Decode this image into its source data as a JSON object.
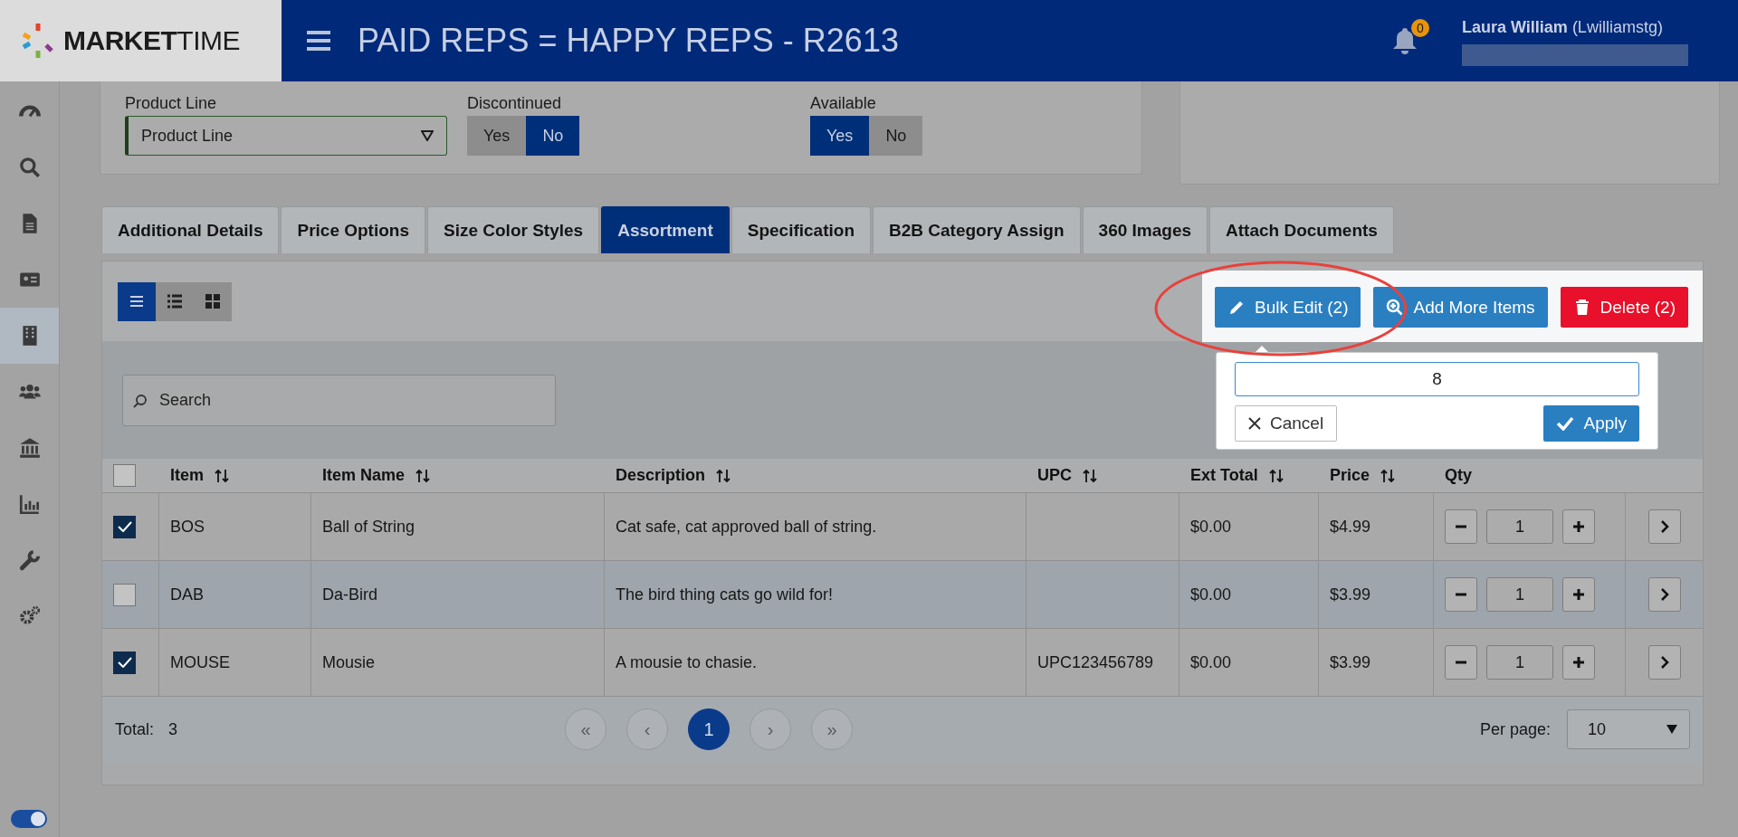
{
  "header": {
    "logo": "**MARKET**TIME",
    "title": "PAID REPS = HAPPY REPS - R2613",
    "notification_count": "0",
    "user_name": "Laura William",
    "user_login": "(Lwilliamstg)"
  },
  "sidebar": {
    "items": [
      {
        "kind": "dashboard",
        "selected": false
      },
      {
        "kind": "search",
        "selected": false
      },
      {
        "kind": "document",
        "selected": false
      },
      {
        "kind": "card",
        "selected": false
      },
      {
        "kind": "building",
        "selected": true
      },
      {
        "kind": "people",
        "selected": false
      },
      {
        "kind": "bank",
        "selected": false
      },
      {
        "kind": "chart",
        "selected": false
      },
      {
        "kind": "wrench",
        "selected": false
      },
      {
        "kind": "gears",
        "selected": false
      }
    ],
    "toggle_on": true
  },
  "filters": [
    {
      "kind": "select",
      "label": "Product Line",
      "value": "Product Line"
    },
    {
      "kind": "toggle",
      "label": "Discontinued",
      "options": [
        {
          "label": "Yes",
          "selected": false
        },
        {
          "label": "No",
          "selected": true
        }
      ]
    },
    {
      "kind": "toggle",
      "label": "Available",
      "options": [
        {
          "label": "Yes",
          "selected": true
        },
        {
          "label": "No",
          "selected": false
        }
      ]
    }
  ],
  "tabs": [
    {
      "label": "Additional Details",
      "selected": false
    },
    {
      "label": "Price Options",
      "selected": false
    },
    {
      "label": "Size Color Styles",
      "selected": false
    },
    {
      "label": "Assortment",
      "selected": true
    },
    {
      "label": "Specification",
      "selected": false
    },
    {
      "label": "B2B Category Assign",
      "selected": false
    },
    {
      "label": "360 Images",
      "selected": false
    },
    {
      "label": "Attach Documents",
      "selected": false
    }
  ],
  "view_modes": [
    {
      "kind": "list",
      "selected": true
    },
    {
      "kind": "table",
      "selected": false
    },
    {
      "kind": "grid",
      "selected": false
    }
  ],
  "actions": [
    {
      "kind": "edit",
      "label": "Bulk Edit (2)"
    },
    {
      "kind": "add",
      "label": "Add More Items"
    },
    {
      "kind": "delete",
      "label": "Delete (2)"
    }
  ],
  "bulk_edit_popover": {
    "value": "8",
    "cancel": "Cancel",
    "apply": "Apply"
  },
  "search": {
    "placeholder": "Search"
  },
  "table": {
    "all_selected": false,
    "columns": [
      {
        "label": "Item",
        "sortable": true
      },
      {
        "label": "Item Name",
        "sortable": true
      },
      {
        "label": "Description",
        "sortable": true
      },
      {
        "label": "UPC",
        "sortable": true
      },
      {
        "label": "Ext Total",
        "sortable": true
      },
      {
        "label": "Price",
        "sortable": true
      },
      {
        "label": "Qty",
        "sortable": false
      }
    ],
    "rows": [
      {
        "selected": true,
        "item": "BOS",
        "item_name": "Ball of String",
        "description": "Cat safe, cat approved ball of string.",
        "ext_total": "$0.00",
        "price": "$4.99",
        "qty": "1"
      },
      {
        "selected": false,
        "item": "DAB",
        "item_name": "Da-Bird",
        "description": "The bird thing cats go wild for!",
        "ext_total": "$0.00",
        "price": "$3.99",
        "qty": "1"
      },
      {
        "selected": true,
        "item": "MOUSE",
        "item_name": "Mousie",
        "description": "A mousie to chasie.",
        "upc": "UPC123456789",
        "ext_total": "$0.00",
        "price": "$3.99",
        "qty": "1"
      }
    ]
  },
  "pagination": {
    "total_label": "Total:",
    "total": "3",
    "first": "«",
    "prev": "‹",
    "pages": [
      {
        "label": "1",
        "selected": true
      }
    ],
    "next": "›",
    "last": "»",
    "per_page_label": "Per page:",
    "per_page": "10"
  }
}
